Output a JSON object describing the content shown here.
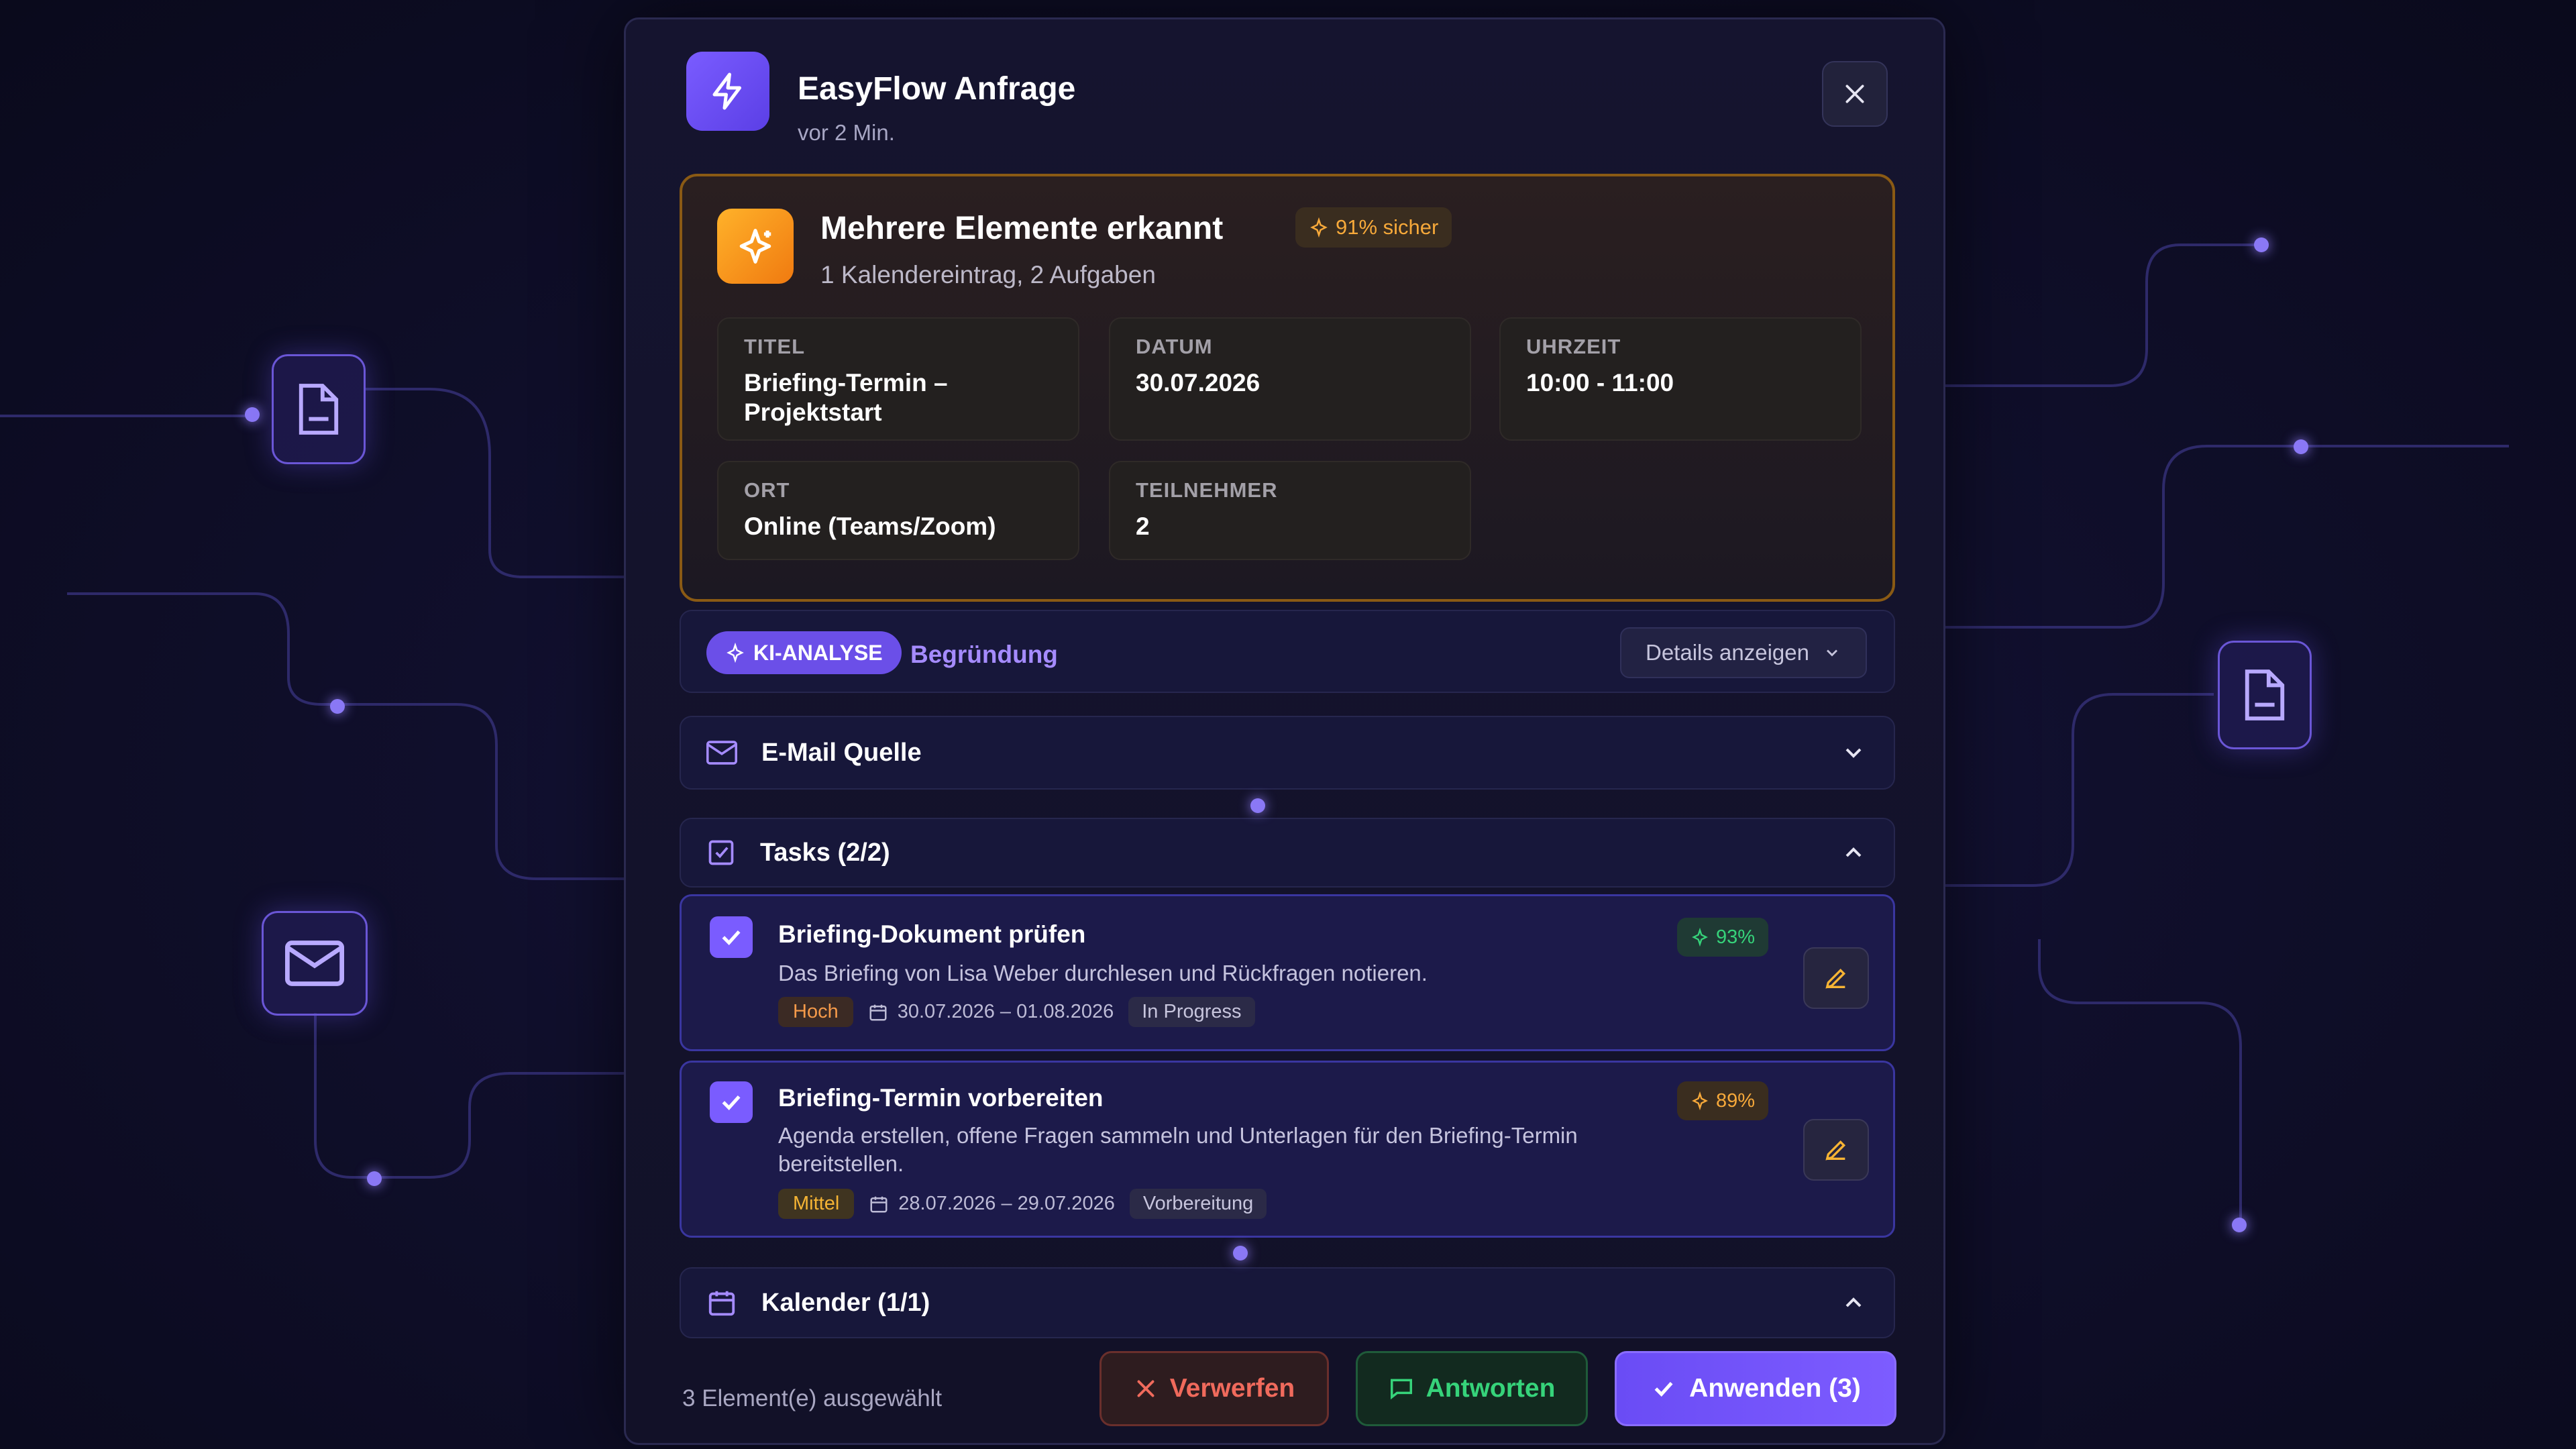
{
  "modal": {
    "title": "EasyFlow Anfrage",
    "subtitle": "vor 2 Min.",
    "accent_color": "#6b4fe8"
  },
  "detection": {
    "title": "Mehrere Elemente erkannt",
    "confidence": "91% sicher",
    "summary": "1 Kalendereintrag, 2 Aufgaben",
    "fields": {
      "titel": {
        "label": "TITEL",
        "value": "Briefing-Termin – Projektstart"
      },
      "datum": {
        "label": "DATUM",
        "value": "30.07.2026"
      },
      "uhrzeit": {
        "label": "UHRZEIT",
        "value": "10:00 - 11:00"
      },
      "ort": {
        "label": "ORT",
        "value": "Online (Teams/Zoom)"
      },
      "teilnehmer": {
        "label": "TEILNEHMER",
        "value": "2"
      }
    }
  },
  "analysis": {
    "badge": "KI-ANALYSE",
    "link": "Begründung",
    "details_button": "Details anzeigen"
  },
  "sections": {
    "email": "E-Mail Quelle",
    "tasks": "Tasks (2/2)",
    "calendar": "Kalender (1/1)"
  },
  "tasks": [
    {
      "title": "Briefing-Dokument prüfen",
      "description": "Das Briefing von Lisa Weber durchlesen und Rückfragen notieren.",
      "priority": "Hoch",
      "dates": "30.07.2026 – 01.08.2026",
      "status": "In Progress",
      "confidence": "93%",
      "checked": true
    },
    {
      "title": "Briefing-Termin vorbereiten",
      "description": "Agenda erstellen, offene Fragen sammeln und Unterlagen für den Briefing-Termin bereitstellen.",
      "priority": "Mittel",
      "dates": "28.07.2026 – 29.07.2026",
      "status": "Vorbereitung",
      "confidence": "89%",
      "checked": true
    }
  ],
  "footer": {
    "selection": "3 Element(e) ausgewählt",
    "discard": "Verwerfen",
    "reply": "Antworten",
    "apply": "Anwenden (3)"
  },
  "colors": {
    "apply": "#6b4fe8",
    "discard": "#f06a5c",
    "reply": "#36d37a",
    "warning": "#f7a93a"
  }
}
